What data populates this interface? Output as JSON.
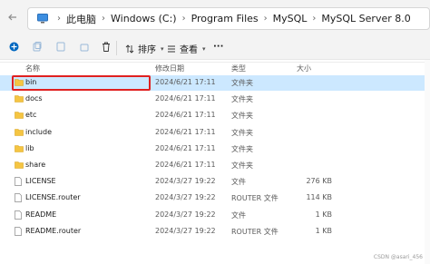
{
  "breadcrumbs": [
    "此电脑",
    "Windows (C:)",
    "Program Files",
    "MySQL",
    "MySQL Server 8.0"
  ],
  "toolbar": {
    "sort_label": "排序",
    "view_label": "查看",
    "more_label": "···"
  },
  "columns": {
    "name": "名称",
    "date": "修改日期",
    "type": "类型",
    "size": "大小"
  },
  "rows": [
    {
      "name": "bin",
      "date": "2024/6/21 17:11",
      "type": "文件夹",
      "size": "",
      "kind": "folder",
      "selected": true
    },
    {
      "name": "docs",
      "date": "2024/6/21 17:11",
      "type": "文件夹",
      "size": "",
      "kind": "folder"
    },
    {
      "name": "etc",
      "date": "2024/6/21 17:11",
      "type": "文件夹",
      "size": "",
      "kind": "folder"
    },
    {
      "name": "include",
      "date": "2024/6/21 17:11",
      "type": "文件夹",
      "size": "",
      "kind": "folder"
    },
    {
      "name": "lib",
      "date": "2024/6/21 17:11",
      "type": "文件夹",
      "size": "",
      "kind": "folder"
    },
    {
      "name": "share",
      "date": "2024/6/21 17:11",
      "type": "文件夹",
      "size": "",
      "kind": "folder"
    },
    {
      "name": "LICENSE",
      "date": "2024/3/27 19:22",
      "type": "文件",
      "size": "276 KB",
      "kind": "file"
    },
    {
      "name": "LICENSE.router",
      "date": "2024/3/27 19:22",
      "type": "ROUTER 文件",
      "size": "114 KB",
      "kind": "file"
    },
    {
      "name": "README",
      "date": "2024/3/27 19:22",
      "type": "文件",
      "size": "1 KB",
      "kind": "file"
    },
    {
      "name": "README.router",
      "date": "2024/3/27 19:22",
      "type": "ROUTER 文件",
      "size": "1 KB",
      "kind": "file"
    }
  ],
  "watermark": "CSDN @asari_456",
  "colors": {
    "selected_bg": "#cce8ff",
    "highlight_box": "#e02020",
    "folder": "#f5c542",
    "accent": "#0067c0"
  },
  "icons": [
    "back-icon",
    "up-icon",
    "monitor-icon",
    "chevron-right-icon",
    "new-item-icon",
    "copy-icon",
    "delete-icon",
    "sort-icon",
    "view-icon",
    "folder-icon",
    "file-icon"
  ]
}
